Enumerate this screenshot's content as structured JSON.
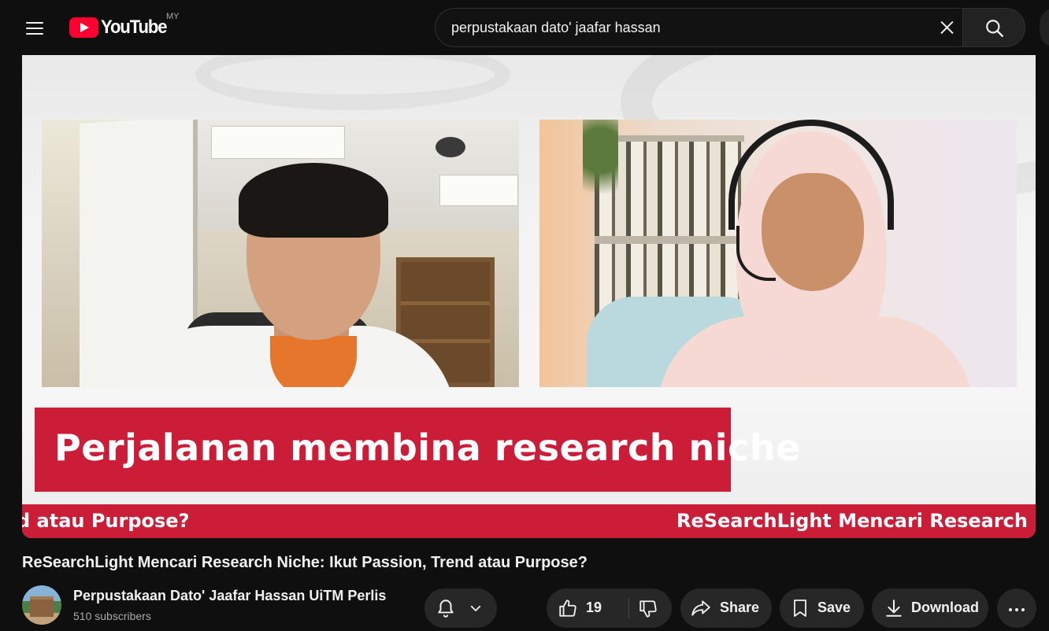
{
  "header": {
    "logo_text": "YouTube",
    "country_code": "MY",
    "search_value": "perpustakaan dato' jaafar hassan"
  },
  "video": {
    "caption": "Perjalanan membina research niche",
    "ticker_left": "d atau Purpose?",
    "ticker_right": "ReSearchLight Mencari Research",
    "caption_color": "#cc1d38"
  },
  "meta": {
    "title": "ReSearchLight Mencari Research Niche: Ikut Passion, Trend atau Purpose?",
    "channel_name": "Perpustakaan Dato' Jaafar Hassan UiTM Perlis",
    "subscribers": "510 subscribers"
  },
  "actions": {
    "likes": "19",
    "share_label": "Share",
    "save_label": "Save",
    "download_label": "Download"
  },
  "colors": {
    "background": "#0f0f0f",
    "pill": "#272727",
    "brand_red": "#ff0033"
  }
}
